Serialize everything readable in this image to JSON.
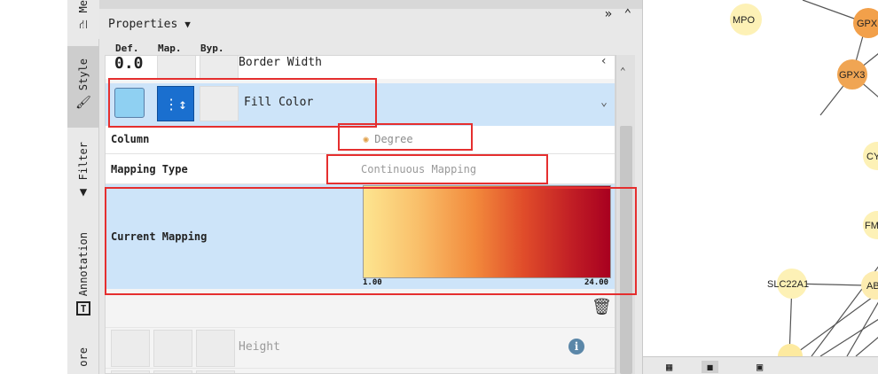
{
  "sidebar": {
    "tabs": [
      {
        "label": "Me",
        "icon": "share-icon"
      },
      {
        "label": "Style",
        "icon": "brush-icon"
      },
      {
        "label": "Filter",
        "icon": "filter-icon"
      },
      {
        "label": "Annotation",
        "icon": "text-icon"
      },
      {
        "label": "ore",
        "icon": ""
      }
    ]
  },
  "properties": {
    "title": "Properties",
    "columns": {
      "def": "Def.",
      "map": "Map.",
      "byp": "Byp."
    },
    "border_width": {
      "value": "0.0",
      "label": "Border Width"
    },
    "fill_color": {
      "label": "Fill Color",
      "swatch": "#8fd0f2"
    },
    "column": {
      "label": "Column",
      "value": "Degree"
    },
    "mapping_type": {
      "label": "Mapping Type",
      "value": "Continuous Mapping"
    },
    "current_mapping": {
      "label": "Current Mapping",
      "min": "1.00",
      "max": "24.00",
      "colors": [
        "#fde590",
        "#a80020"
      ]
    },
    "height": {
      "label": "Height"
    }
  },
  "network": {
    "nodes": [
      "MPO",
      "GPX",
      "GPX3",
      "CY",
      "FM",
      "SLC22A1",
      "AB"
    ]
  }
}
